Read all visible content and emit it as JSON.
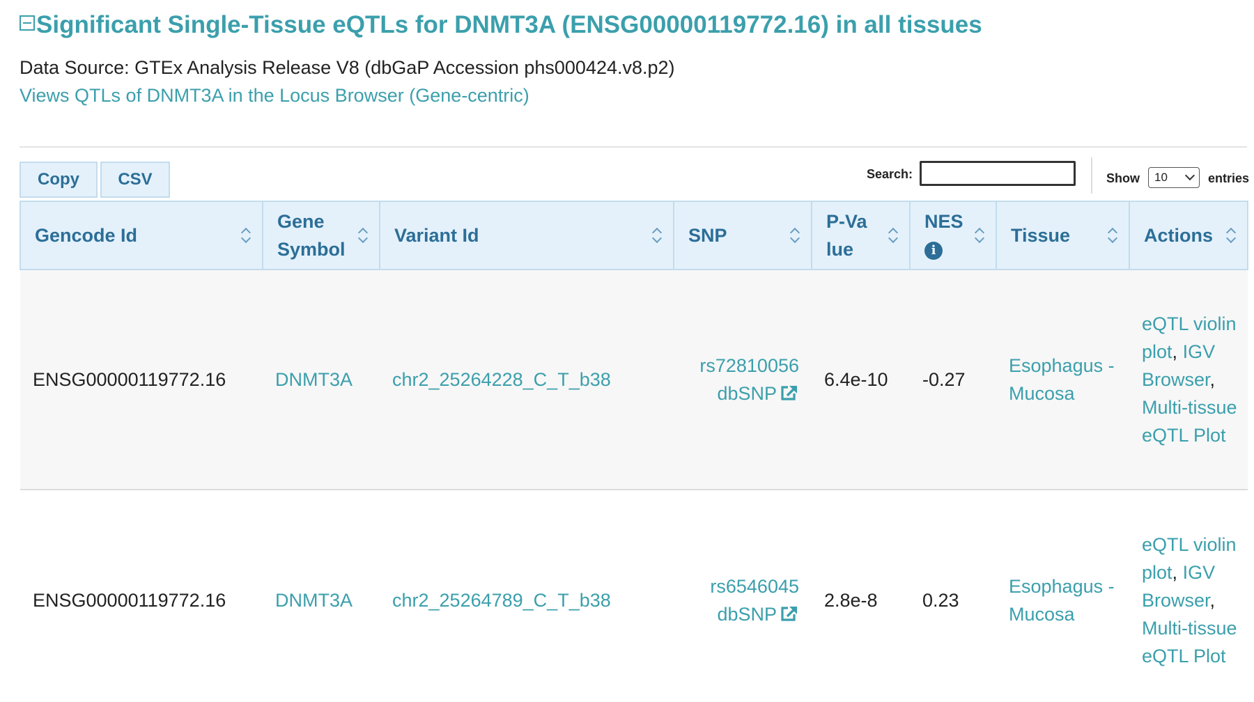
{
  "header": {
    "title": "Significant Single-Tissue eQTLs for DNMT3A (ENSG00000119772.16) in all tissues",
    "data_source": "Data Source: GTEx Analysis Release V8 (dbGaP Accession phs000424.v8.p2)",
    "locus_link": "Views QTLs of DNMT3A in the Locus Browser (Gene-centric)"
  },
  "toolbar": {
    "copy_label": "Copy",
    "csv_label": "CSV",
    "search_label": "Search:",
    "search_value": "",
    "show_label": "Show",
    "show_value": "10",
    "entries_label": "entries"
  },
  "table": {
    "columns": [
      "Gencode Id",
      "Gene Symbol",
      "Variant Id",
      "SNP",
      "P-Value",
      "NES",
      "Tissue",
      "Actions"
    ],
    "rows": [
      {
        "gencode_id": "ENSG00000119772.16",
        "gene_symbol": "DNMT3A",
        "variant_id": "chr2_25264228_C_T_b38",
        "snp": "rs72810056",
        "snp_link": "dbSNP",
        "p_value": "6.4e-10",
        "nes": "-0.27",
        "tissue": "Esophagus - Mucosa",
        "actions": [
          "eQTL violin plot",
          "IGV Browser",
          "Multi-tissue eQTL Plot"
        ]
      },
      {
        "gencode_id": "ENSG00000119772.16",
        "gene_symbol": "DNMT3A",
        "variant_id": "chr2_25264789_C_T_b38",
        "snp": "rs6546045",
        "snp_link": "dbSNP",
        "p_value": "2.8e-8",
        "nes": "0.23",
        "tissue": "Esophagus - Mucosa",
        "actions": [
          "eQTL violin plot",
          "IGV Browser",
          "Multi-tissue eQTL Plot"
        ]
      }
    ]
  },
  "colors": {
    "link": "#3b9fac",
    "header_bg": "#e4f1fb",
    "header_text": "#2c6e97"
  },
  "icons": {
    "collapse": "minus-square-icon",
    "info": "info-circle-icon",
    "external_link": "external-link-icon",
    "sort": "sort-icon"
  }
}
